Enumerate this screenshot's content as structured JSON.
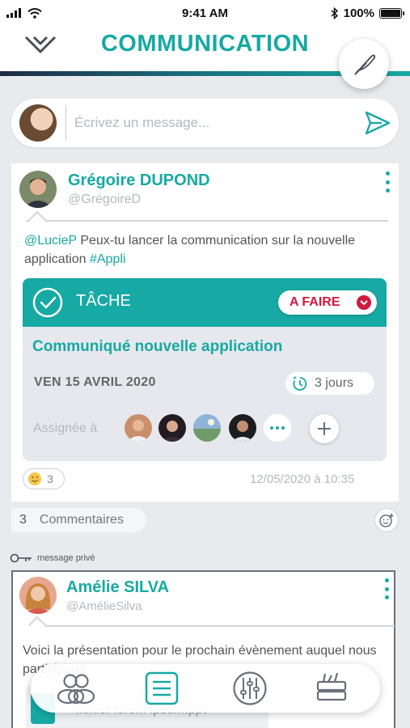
{
  "status_bar": {
    "time": "9:41 AM",
    "battery": "100%",
    "battery_level": 1.0
  },
  "header": {
    "title": "COMMUNICATION"
  },
  "composer": {
    "placeholder": "Écrivez un message..."
  },
  "post": {
    "author_name": "Grégoire DUPOND",
    "author_handle": "@GrégoireD",
    "mention": "@LucieP",
    "text_middle": " Peux-tu lancer la communication sur la nouvelle application ",
    "hashtag": "#Appli",
    "task": {
      "title": "TÂCHE",
      "status": "A FAIRE",
      "name": "Communiqué nouvelle application",
      "date": "VEN 15 AVRIL 2020",
      "duration": "3 jours",
      "assigned_label": "Assignée à"
    },
    "reaction_count": "3",
    "timestamp": "12/05/2020 à 10:35"
  },
  "comments": {
    "count": "3",
    "label": "Commentaires"
  },
  "private_label": "message privé",
  "post2": {
    "author_name": "Amélie SILVA",
    "author_handle": "@AmélieSilva",
    "text": "Voici la présentation pour le prochain évènement auquel nous participons",
    "attachment_name": "fichier lorem ipsum.ppt"
  },
  "nav": {
    "items": [
      "groups-icon",
      "feed-icon",
      "settings-sliders-icon",
      "tools-icon"
    ],
    "active_color": "#17a9a3",
    "inactive_color": "#6c6f7b"
  },
  "colors": {
    "accent": "#17a9a3",
    "status_red": "#d0193f"
  }
}
